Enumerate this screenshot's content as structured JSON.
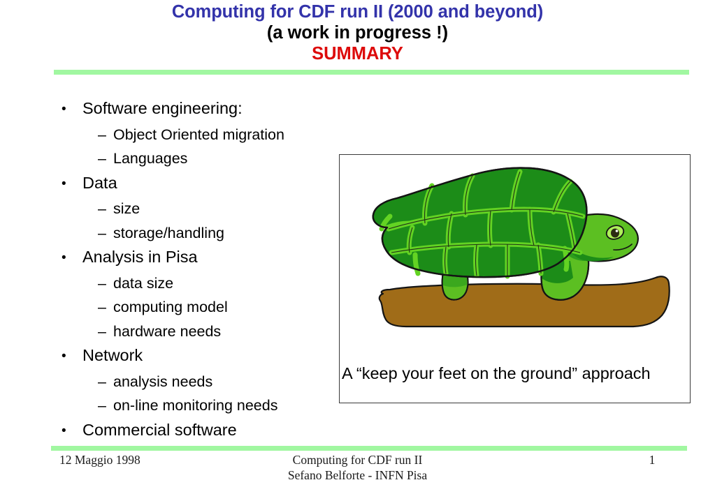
{
  "slide": {
    "title_line1": "Computing for CDF run II (2000 and beyond)",
    "title_line2": "(a work in progress !)",
    "title_line3": "SUMMARY",
    "title_color_line1": "#3333AA",
    "title_color_line2": "#000000",
    "title_color_line3": "#DD0A0A",
    "rule_color": "#A1F7A1"
  },
  "outline": {
    "items": [
      {
        "level": 1,
        "marker": "•",
        "text": "Software engineering:"
      },
      {
        "level": 2,
        "marker": "–",
        "text": "Object Oriented migration"
      },
      {
        "level": 2,
        "marker": "–",
        "text": "Languages"
      },
      {
        "level": 1,
        "marker": "•",
        "text": "Data"
      },
      {
        "level": 2,
        "marker": "–",
        "text": "size"
      },
      {
        "level": 2,
        "marker": "–",
        "text": "storage/handling"
      },
      {
        "level": 1,
        "marker": "•",
        "text": "Analysis in Pisa"
      },
      {
        "level": 2,
        "marker": "–",
        "text": "data size"
      },
      {
        "level": 2,
        "marker": "–",
        "text": "computing model"
      },
      {
        "level": 2,
        "marker": "–",
        "text": "hardware needs"
      },
      {
        "level": 1,
        "marker": "•",
        "text": "Network"
      },
      {
        "level": 2,
        "marker": "–",
        "text": "analysis needs"
      },
      {
        "level": 2,
        "marker": "–",
        "text": "on-line monitoring needs"
      },
      {
        "level": 1,
        "marker": "•",
        "text": "Commercial software"
      }
    ]
  },
  "picture": {
    "caption": "A “keep your feet on the ground” approach",
    "illustration_name": "tortoise-on-log-clipart",
    "colors": {
      "shell_dark": "#1C8C18",
      "shell_seam": "#63D323",
      "skin_light": "#5CBF22",
      "skin_mid": "#2E9E1E",
      "outline": "#1a1a1a",
      "log": "#A06C18",
      "eye_ring": "#9CE84A",
      "eye_pupil": "#2b2b12"
    }
  },
  "footer": {
    "date": "12 Maggio 1998",
    "center_line1": "Computing for CDF run II",
    "center_line2": "Sefano Belforte - INFN Pisa",
    "page_number": "1"
  }
}
